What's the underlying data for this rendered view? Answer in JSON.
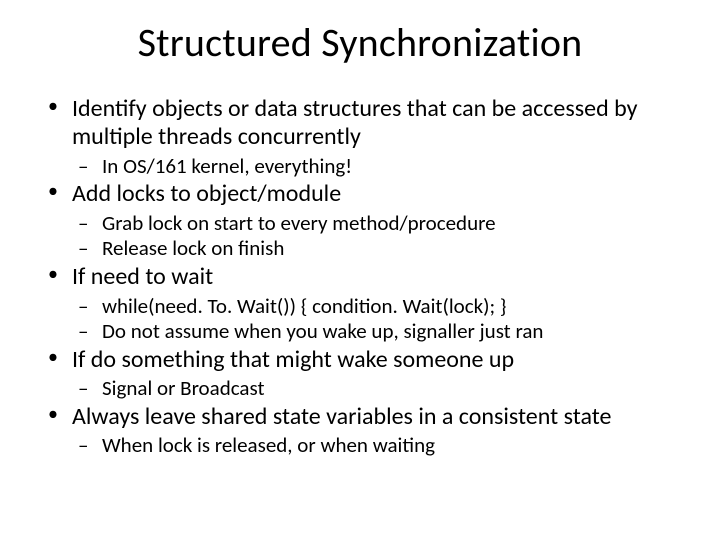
{
  "title": "Structured Synchronization",
  "bullets": [
    {
      "text": "Identify objects or data structures that can be accessed by multiple threads concurrently",
      "sub": [
        "In OS/161 kernel, everything!"
      ]
    },
    {
      "text": "Add locks to object/module",
      "sub": [
        "Grab lock on start to every method/procedure",
        "Release lock on finish"
      ]
    },
    {
      "text": "If need to wait",
      "sub": [
        "while(need. To. Wait()) { condition. Wait(lock); }",
        "Do not assume when you wake up, signaller just ran"
      ]
    },
    {
      "text": "If do something that might wake someone up",
      "sub": [
        "Signal or Broadcast"
      ]
    },
    {
      "text": "Always leave shared state variables in a consistent state",
      "sub": [
        "When lock is released, or when waiting"
      ]
    }
  ]
}
